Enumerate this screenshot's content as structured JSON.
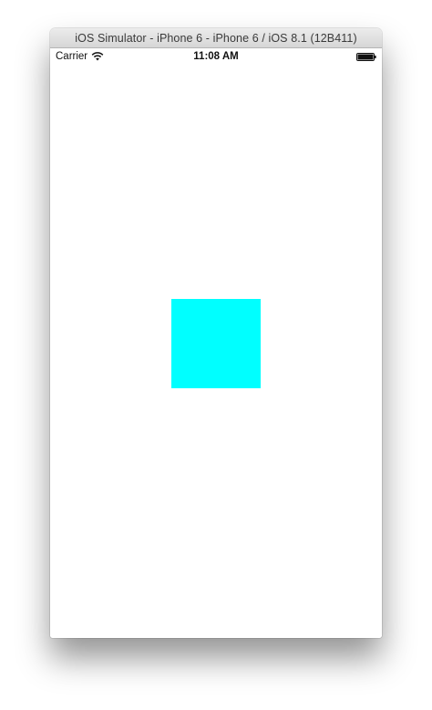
{
  "window": {
    "title": "iOS Simulator - iPhone 6 - iPhone 6 / iOS 8.1 (12B411)"
  },
  "status_bar": {
    "carrier": "Carrier",
    "time": "11:08 AM",
    "wifi_icon": "wifi-icon",
    "battery_icon": "battery-icon",
    "battery_level": 1.0
  },
  "screen": {
    "square_color": "#00FFFF",
    "background_color": "#FFFFFF"
  }
}
